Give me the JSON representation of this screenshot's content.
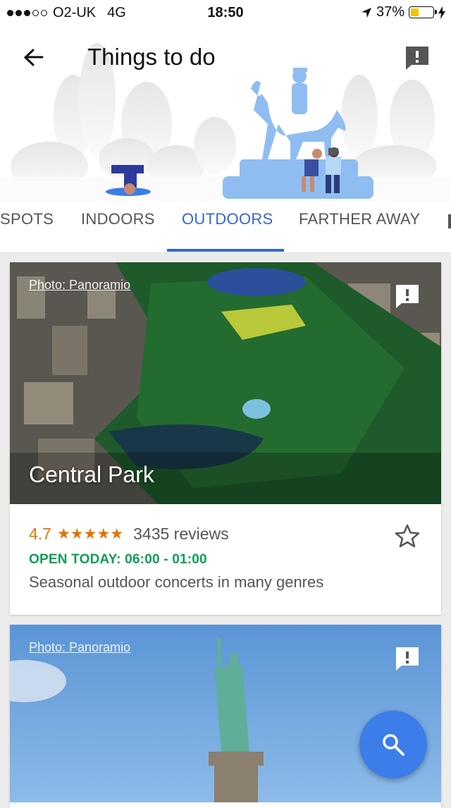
{
  "status_bar": {
    "carrier": "O2-UK",
    "network": "4G",
    "time": "18:50",
    "battery": "37%",
    "battery_level": 0.37,
    "signal_bars": 3,
    "signal_total": 5
  },
  "header": {
    "title": "Things to do",
    "back_icon": "arrow-back-icon",
    "feedback_icon": "feedback-flag-icon"
  },
  "tabs": [
    {
      "label": "SPOTS",
      "active": false
    },
    {
      "label": "INDOORS",
      "active": false
    },
    {
      "label": "OUTDOORS",
      "active": true
    },
    {
      "label": "FARTHER AWAY",
      "active": false
    }
  ],
  "cards": [
    {
      "photo_credit": "Photo: Panoramio",
      "name": "Central Park",
      "rating": "4.7",
      "stars": "★★★★★",
      "reviews": "3435 reviews",
      "hours": "OPEN TODAY: 06:00 - 01:00",
      "description": "Seasonal outdoor concerts in many genres"
    },
    {
      "photo_credit": "Photo: Panoramio"
    }
  ],
  "colors": {
    "accent": "#3367d6",
    "rating": "#e37400",
    "open": "#0f9d58",
    "fab": "#3b7de9"
  },
  "fab": {
    "icon": "search-icon"
  }
}
